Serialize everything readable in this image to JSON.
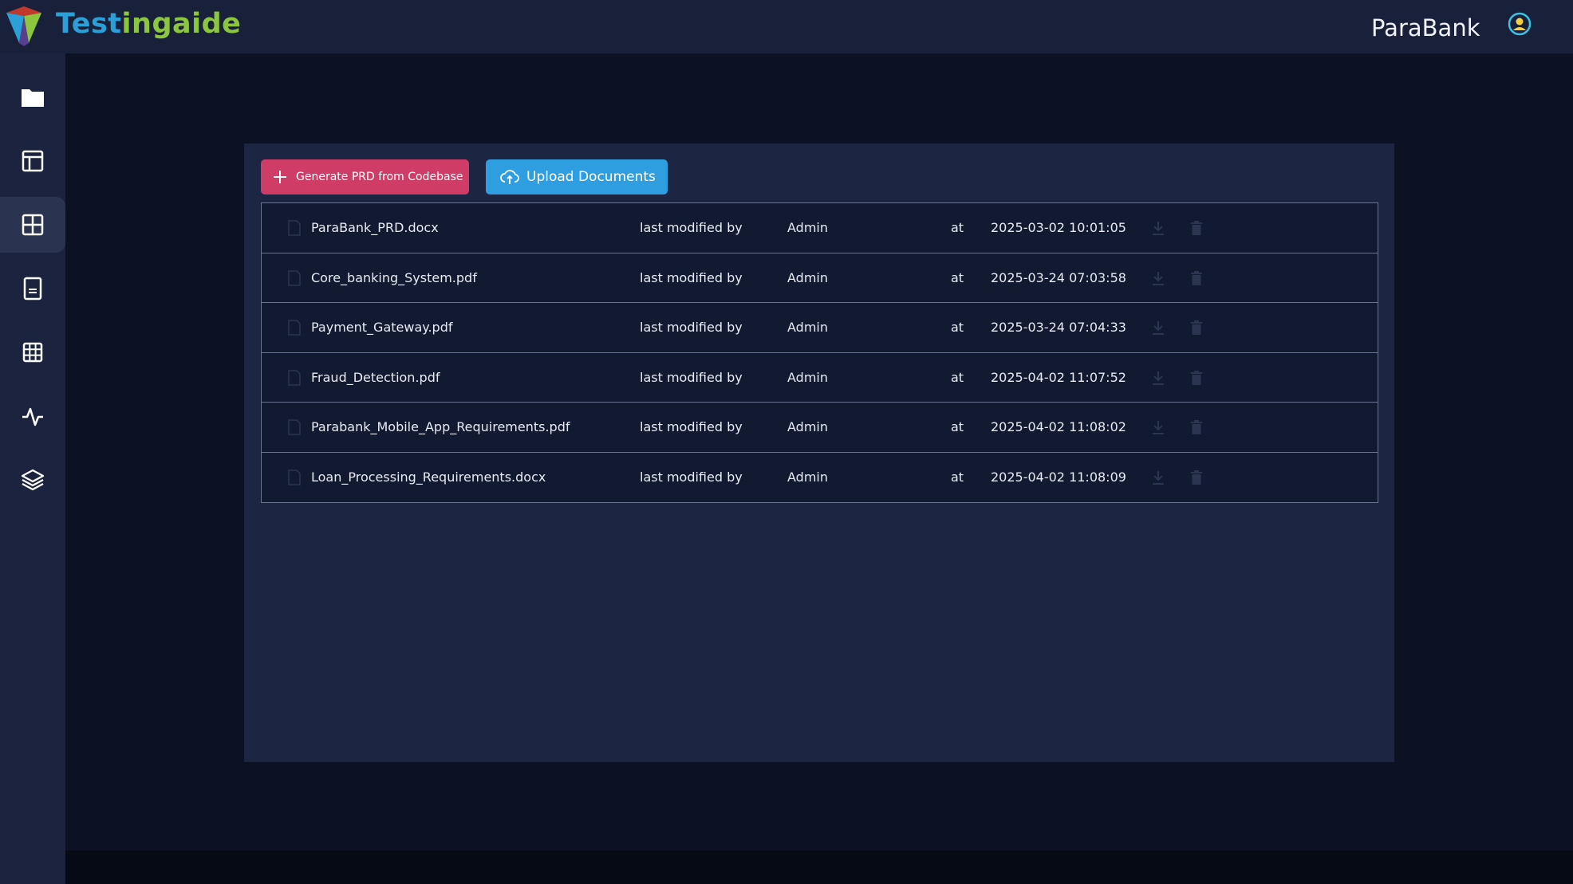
{
  "app": {
    "brand_part1": "Test",
    "brand_part2": "ingaide",
    "project_name": "ParaBank"
  },
  "sidebar": {
    "items": [
      {
        "icon": "folder-icon",
        "active": false
      },
      {
        "icon": "layout-icon",
        "active": false
      },
      {
        "icon": "add-box-icon",
        "active": true
      },
      {
        "icon": "document-icon",
        "active": false
      },
      {
        "icon": "grid-table-icon",
        "active": false
      },
      {
        "icon": "activity-icon",
        "active": false
      },
      {
        "icon": "layers-icon",
        "active": false
      }
    ]
  },
  "toolbar": {
    "generate_label": "Generate PRD from Codebase",
    "upload_label": "Upload Documents"
  },
  "documents": [
    {
      "name": "ParaBank_PRD.docx",
      "modified_label": "last modified by",
      "author": "Admin",
      "at_label": "at",
      "timestamp": "2025-03-02 10:01:05"
    },
    {
      "name": "Core_banking_System.pdf",
      "modified_label": "last modified by",
      "author": "Admin",
      "at_label": "at",
      "timestamp": "2025-03-24 07:03:58"
    },
    {
      "name": "Payment_Gateway.pdf",
      "modified_label": "last modified by",
      "author": "Admin",
      "at_label": "at",
      "timestamp": "2025-03-24 07:04:33"
    },
    {
      "name": "Fraud_Detection.pdf",
      "modified_label": "last modified by",
      "author": "Admin",
      "at_label": "at",
      "timestamp": "2025-04-02 11:07:52"
    },
    {
      "name": "Parabank_Mobile_App_Requirements.pdf",
      "modified_label": "last modified by",
      "author": "Admin",
      "at_label": "at",
      "timestamp": "2025-04-02 11:08:02"
    },
    {
      "name": "Loan_Processing_Requirements.docx",
      "modified_label": "last modified by",
      "author": "Admin",
      "at_label": "at",
      "timestamp": "2025-04-02 11:08:09"
    }
  ],
  "colors": {
    "brand_blue": "#2a9fd8",
    "brand_green": "#8cc63f",
    "generate_button": "#cf3d66",
    "upload_button": "#2e9ee0",
    "user_icon": "#3cc0e0"
  }
}
